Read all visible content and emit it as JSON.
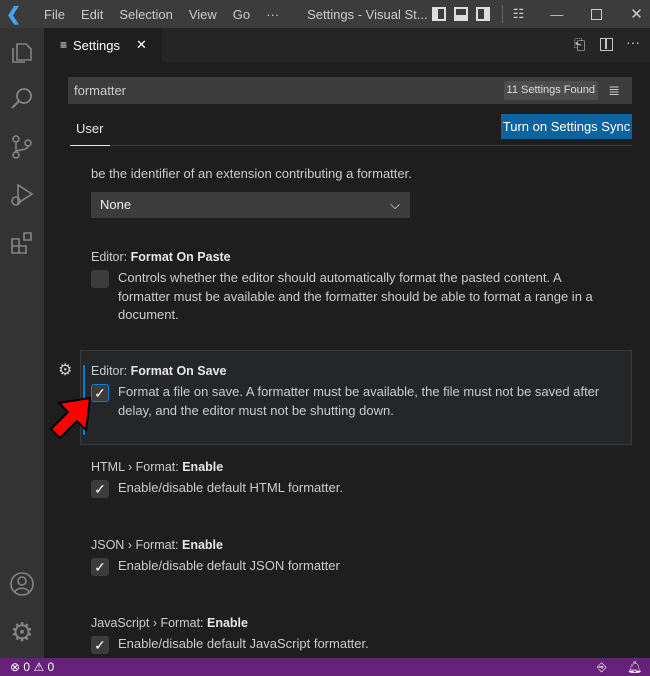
{
  "titlebar": {
    "menus": [
      "File",
      "Edit",
      "Selection",
      "View",
      "Go",
      "···"
    ],
    "title": "Settings - Visual St..."
  },
  "tab": {
    "label": "Settings",
    "close": "✕"
  },
  "search": {
    "value": "formatter",
    "found": "11 Settings Found"
  },
  "scope": {
    "user": "User",
    "sync": "Turn on Settings Sync"
  },
  "settings": [
    {
      "desc": "be the identifier of an extension contributing a formatter.",
      "value": "None"
    },
    {
      "prefix": "Editor: ",
      "name": "Format On Paste",
      "checked": false,
      "desc": "Controls whether the editor should automatically format the pasted content. A formatter must be available and the formatter should be able to format a range in a document."
    },
    {
      "prefix": "Editor: ",
      "name": "Format On Save",
      "checked": true,
      "desc": "Format a file on save. A formatter must be available, the file must not be saved after delay, and the editor must not be shutting down."
    },
    {
      "prefix": "HTML › Format: ",
      "name": "Enable",
      "checked": true,
      "desc": "Enable/disable default HTML formatter."
    },
    {
      "prefix": "JSON › Format: ",
      "name": "Enable",
      "checked": true,
      "desc": "Enable/disable default JSON formatter"
    },
    {
      "prefix": "JavaScript › Format: ",
      "name": "Enable",
      "checked": true,
      "desc": "Enable/disable default JavaScript formatter."
    }
  ],
  "status": {
    "errors": "0",
    "warnings": "0"
  },
  "colors": {
    "accent": "#0e639c",
    "status": "#68217a",
    "arrow": "#ff0000"
  }
}
